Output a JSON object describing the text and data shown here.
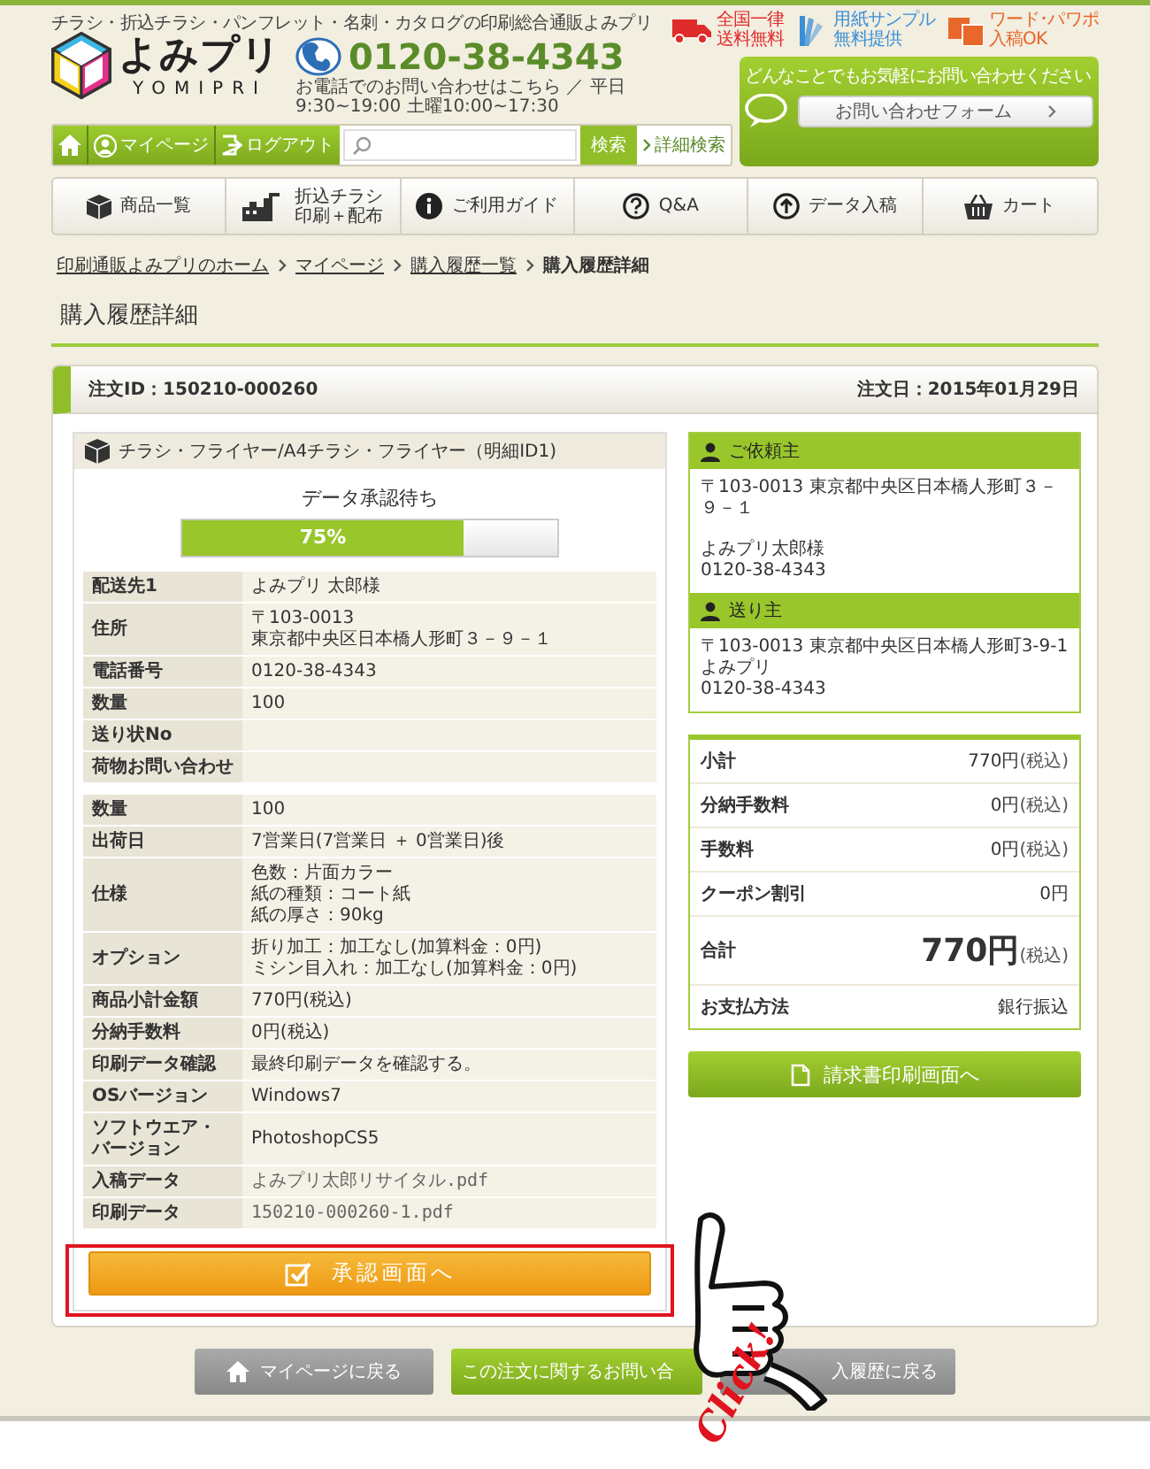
{
  "header": {
    "tagline": "チラシ・折込チラシ・パンフレット・名刺・カタログの印刷総合通販よみプリ",
    "logo": {
      "name": "よみプリ",
      "romaji": "YOMIPRI"
    },
    "phone": {
      "number": "0120-38-4343",
      "hours": "お電話でのお問い合わせはこちら ／ 平日9:30~19:00 土曜10:00~17:30"
    },
    "badges": [
      {
        "kind": "truck",
        "lines": [
          "全国一律",
          "送料無料"
        ],
        "color": "#e02b2b"
      },
      {
        "kind": "paper",
        "lines": [
          "用紙サンプル",
          "無料提供"
        ],
        "color": "#3a8fd6"
      },
      {
        "kind": "wp",
        "lines": [
          "ワード･パワポ",
          "入稿OK"
        ],
        "color": "#e8672a"
      }
    ],
    "toolbar": {
      "items": [
        {
          "kind": "home"
        },
        {
          "kind": "user",
          "label": "マイページ"
        },
        {
          "kind": "logout",
          "label": "ログアウト"
        }
      ],
      "search_button": "検索",
      "advanced_link": "詳細検索"
    },
    "contact": {
      "message": "どんなことでもお気軽にお問い合わせください",
      "button": "お問い合わせフォーム"
    }
  },
  "nav": [
    {
      "kind": "box",
      "label": "商品一覧"
    },
    {
      "kind": "delivery",
      "lines": [
        "折込チラシ",
        "印刷＋配布"
      ]
    },
    {
      "kind": "info",
      "label": "ご利用ガイド"
    },
    {
      "kind": "question",
      "label": "Q&A"
    },
    {
      "kind": "upload",
      "label": "データ入稿"
    },
    {
      "kind": "cart",
      "label": "カート"
    }
  ],
  "breadcrumb": [
    {
      "label": "印刷通販よみプリのホーム",
      "current": false
    },
    {
      "label": "マイページ",
      "current": false
    },
    {
      "label": "購入履歴一覧",
      "current": false
    },
    {
      "label": "購入履歴詳細",
      "current": true
    }
  ],
  "page_title": "購入履歴詳細",
  "order": {
    "id": "注文ID：150210-000260",
    "date": "注文日：2015年01月29日"
  },
  "item": {
    "title": "チラシ・フライヤー/A4チラシ・フライヤー（明細ID1)",
    "status": "データ承認待ち",
    "progress": {
      "level": 0.75,
      "reading": "75%"
    },
    "shipping": [
      {
        "kind": "text",
        "label": "配送先1",
        "value": "よみプリ 太郎様"
      },
      {
        "kind": "text",
        "label": "住所",
        "lines": [
          "〒103-0013",
          "東京都中央区日本橋人形町３－９－１"
        ]
      },
      {
        "kind": "text",
        "label": "電話番号",
        "value": "0120-38-4343"
      },
      {
        "kind": "text",
        "label": "数量",
        "value": "100"
      },
      {
        "kind": "text",
        "label": "送り状No"
      },
      {
        "kind": "text",
        "label": "荷物お問い合わせ"
      }
    ],
    "details": [
      {
        "kind": "text",
        "label": "数量",
        "value": "100"
      },
      {
        "kind": "text",
        "label": "出荷日",
        "value": "7営業日(7営業日 ＋ 0営業日)後"
      },
      {
        "kind": "text",
        "label": "仕様",
        "lines": [
          "色数：片面カラー",
          "紙の種類：コート紙",
          "紙の厚さ：90kg"
        ]
      },
      {
        "kind": "text",
        "label": "オプション",
        "lines": [
          "折り加工：加工なし(加算料金：0円)",
          "ミシン目入れ：加工なし(加算料金：0円)"
        ]
      },
      {
        "kind": "text",
        "label": "商品小計金額",
        "value": "770円(税込)"
      },
      {
        "kind": "text",
        "label": "分納手数料",
        "value": "0円(税込)"
      },
      {
        "kind": "text",
        "label": "印刷データ確認",
        "value": "最終印刷データを確認する。"
      },
      {
        "kind": "text",
        "label": "OSバージョン",
        "value": "Windows7"
      },
      {
        "kind": "text",
        "label_lines": [
          "ソフトウエア・",
          "バージョン"
        ],
        "value": "PhotoshopCS5"
      },
      {
        "kind": "file",
        "label": "入稿データ",
        "value": "よみプリ太郎リサイタル.pdf"
      },
      {
        "kind": "file",
        "label": "印刷データ",
        "value": "150210-000260-1.pdf"
      }
    ],
    "approve_button": "承認画面へ"
  },
  "client": {
    "title": "ご依頼主",
    "paragraphs": [
      [
        "〒103-0013 東京都中央区日本橋人形町３－９－１"
      ],
      [
        "よみプリ太郎様",
        "0120-38-4343"
      ]
    ]
  },
  "sender": {
    "title": "送り主",
    "paragraphs": [
      [
        "〒103-0013 東京都中央区日本橋人形町3-9-1",
        "よみプリ",
        "0120-38-4343"
      ]
    ]
  },
  "totals": [
    {
      "kind": "line",
      "label": "小計",
      "value": "770円",
      "tax": "(税込)"
    },
    {
      "kind": "line",
      "label": "分納手数料",
      "value": "0円",
      "tax": "(税込)"
    },
    {
      "kind": "line",
      "label": "手数料",
      "value": "0円",
      "tax": "(税込)"
    },
    {
      "kind": "line",
      "label": "クーポン割引",
      "value": "0円"
    },
    {
      "kind": "grand",
      "label": "合計",
      "value": "770円",
      "tax": "(税込)"
    },
    {
      "kind": "line",
      "label": "お支払方法",
      "value": "銀行振込"
    }
  ],
  "invoice_button": "請求書印刷画面へ",
  "footer_buttons": [
    {
      "kind": "home",
      "label": "マイページに戻る"
    },
    {
      "kind": "primary",
      "label": "この注文に関するお問い合"
    },
    {
      "kind": "plain",
      "label": "入履歴に戻る"
    }
  ],
  "overlay": {
    "click": "Click!"
  }
}
